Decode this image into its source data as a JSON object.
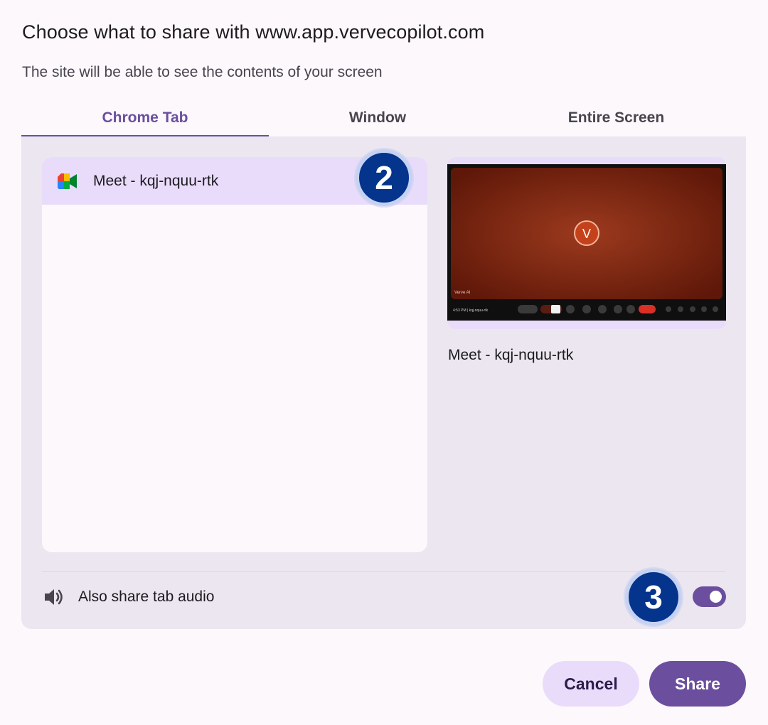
{
  "dialog": {
    "title": "Choose what to share with www.app.vervecopilot.com",
    "subtitle": "The site will be able to see the contents of your screen"
  },
  "tabs": [
    {
      "label": "Chrome Tab",
      "active": true
    },
    {
      "label": "Window",
      "active": false
    },
    {
      "label": "Entire Screen",
      "active": false
    }
  ],
  "tab_list": {
    "items": [
      {
        "label": "Meet - kqj-nquu-rtk",
        "icon": "google-meet-icon",
        "selected": true
      }
    ]
  },
  "preview": {
    "caption": "Meet - kqj-nquu-rtk",
    "avatar_letter": "V",
    "participant_name": "Verve AI",
    "time_code": "4:53 PM | kqj-nquu-rtk"
  },
  "audio": {
    "label": "Also share tab audio",
    "icon": "speaker-icon",
    "enabled": true
  },
  "badges": {
    "step2": "2",
    "step3": "3"
  },
  "buttons": {
    "cancel": "Cancel",
    "share": "Share"
  },
  "colors": {
    "accent": "#6b4f9e",
    "selected_row": "#e9dcfb",
    "panel": "#ebe6ef",
    "badge": "#04348c",
    "end_call": "#d93025"
  }
}
